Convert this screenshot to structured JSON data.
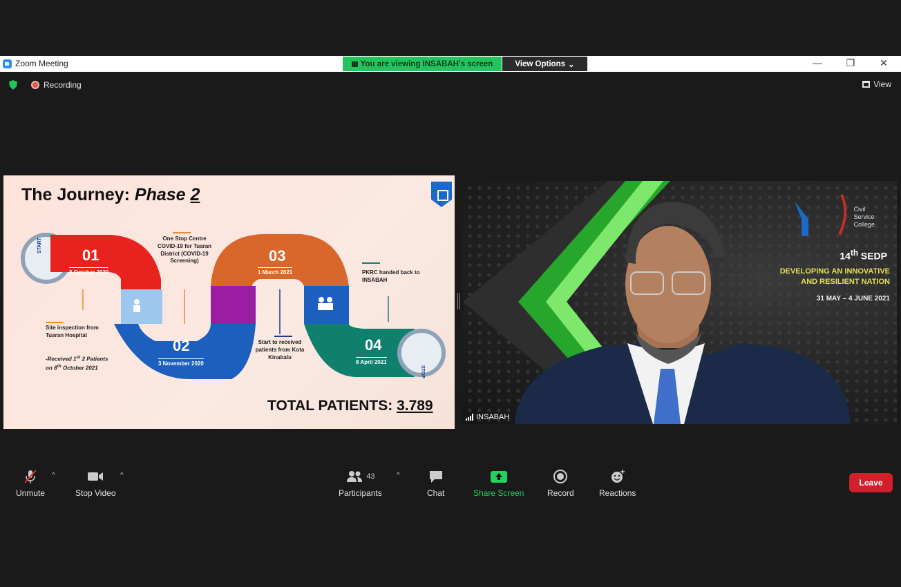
{
  "window": {
    "title": "Zoom Meeting",
    "minimize": "—",
    "restore": "❐",
    "close": "✕"
  },
  "share_banner": {
    "text": "You are viewing INSABAH's screen",
    "view_options": "View Options",
    "caret": "⌄"
  },
  "status": {
    "recording": "Recording",
    "view_label": "View"
  },
  "slide": {
    "title_plain": "The Journey: ",
    "title_italic": "Phase ",
    "title_num": "2",
    "steps": [
      {
        "num": "01",
        "date": "8 October 2020",
        "color": "#e8231f"
      },
      {
        "num": "02",
        "date": "3 November 2020",
        "color": "#1c5fbf"
      },
      {
        "num": "03",
        "date": "1 March 2021",
        "color": "#d9662a"
      },
      {
        "num": "04",
        "date": "8 April 2021",
        "color": "#0f7f6e"
      }
    ],
    "start_label": "START",
    "stop_label": "STOP",
    "notes": {
      "site": "Site inspection from\nTuaran Hospital",
      "received_a": "-Received 1",
      "received_sup1": "st",
      "received_b": " 2 Patients\non 8",
      "received_sup2": "th",
      "received_c": " October 2021",
      "one_stop": "One Stop Centre\nCOVID-19 for Tuaran\nDistrict (COVID-19\nScreening)",
      "start_recv": "Start to received\npatients from Kota\nKinabalu",
      "handed": "PKRC handed back to\nINSABAH"
    },
    "total_label": "TOTAL PATIENTS: ",
    "total_value": "3.789"
  },
  "video": {
    "participant": "INSABAH",
    "org_text": "Civil\nService\nCollege",
    "event_title": "14",
    "event_sup": "th",
    "event_title_rest": " SEDP",
    "event_sub": "DEVELOPING AN INNOVATIVE\nAND RESILIENT NATION",
    "event_date": "31 MAY – 4 JUNE 2021"
  },
  "toolbar": {
    "unmute": "Unmute",
    "stop_video": "Stop Video",
    "participants": "Participants",
    "participant_count": "43",
    "chat": "Chat",
    "share_screen": "Share Screen",
    "record": "Record",
    "reactions": "Reactions",
    "leave": "Leave",
    "caret": "^"
  },
  "colors": {
    "accent_green": "#23c45e",
    "leave_red": "#d0202a",
    "toolbar_bg": "#1a1a1a"
  }
}
